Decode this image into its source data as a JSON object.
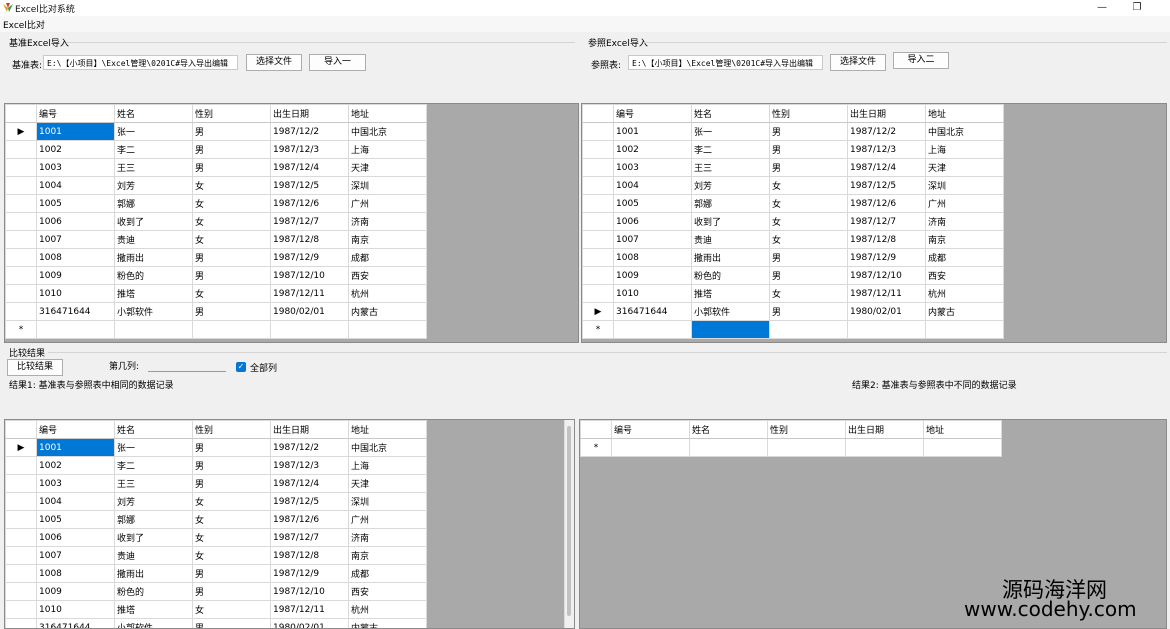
{
  "window": {
    "title": "Excel比对系统",
    "minimize": "—",
    "restore": "❐"
  },
  "menu": {
    "item": "Excel比对"
  },
  "base_group": {
    "title": "基准Excel导入",
    "path_label": "基准表:",
    "path_value": "E:\\【小项目】\\Excel管理\\0201C#导入导出编辑",
    "choose_button": "选择文件",
    "import_button": "导入一"
  },
  "ref_group": {
    "title": "参照Excel导入",
    "path_label": "参照表:",
    "path_value": "E:\\【小项目】\\Excel管理\\0201C#导入导出编辑",
    "choose_button": "选择文件",
    "import_button": "导入二"
  },
  "columns": [
    "编号",
    "姓名",
    "性别",
    "出生日期",
    "地址"
  ],
  "rows": [
    [
      "1001",
      "张一",
      "男",
      "1987/12/2",
      "中国北京"
    ],
    [
      "1002",
      "李二",
      "男",
      "1987/12/3",
      "上海"
    ],
    [
      "1003",
      "王三",
      "男",
      "1987/12/4",
      "天津"
    ],
    [
      "1004",
      "刘芳",
      "女",
      "1987/12/5",
      "深圳"
    ],
    [
      "1005",
      "郭娜",
      "女",
      "1987/12/6",
      "广州"
    ],
    [
      "1006",
      "收到了",
      "女",
      "1987/12/7",
      "济南"
    ],
    [
      "1007",
      "贵迪",
      "女",
      "1987/12/8",
      "南京"
    ],
    [
      "1008",
      "撒雨出",
      "男",
      "1987/12/9",
      "成都"
    ],
    [
      "1009",
      "粉色的",
      "男",
      "1987/12/10",
      "西安"
    ],
    [
      "1010",
      "推塔",
      "女",
      "1987/12/11",
      "杭州"
    ],
    [
      "316471644",
      "小郭软件",
      "男",
      "1980/02/01",
      "内蒙古"
    ]
  ],
  "row_marker": "▶",
  "new_row_marker": "*",
  "compare": {
    "title": "比较结果",
    "button": "比较结果",
    "column_label": "第几列:",
    "column_value": "",
    "all_columns_label": "全部列",
    "all_columns_checked": true,
    "check_mark": "✓",
    "result1_label": "结果1: 基准表与参照表中相同的数据记录",
    "result2_label": "结果2: 基准表与参照表中不同的数据记录"
  },
  "watermark": {
    "line1": "源码海洋网",
    "line2": "www.codehy.com"
  },
  "colors": {
    "selection": "#0078d7",
    "grid_bg": "#a9a9a9"
  }
}
